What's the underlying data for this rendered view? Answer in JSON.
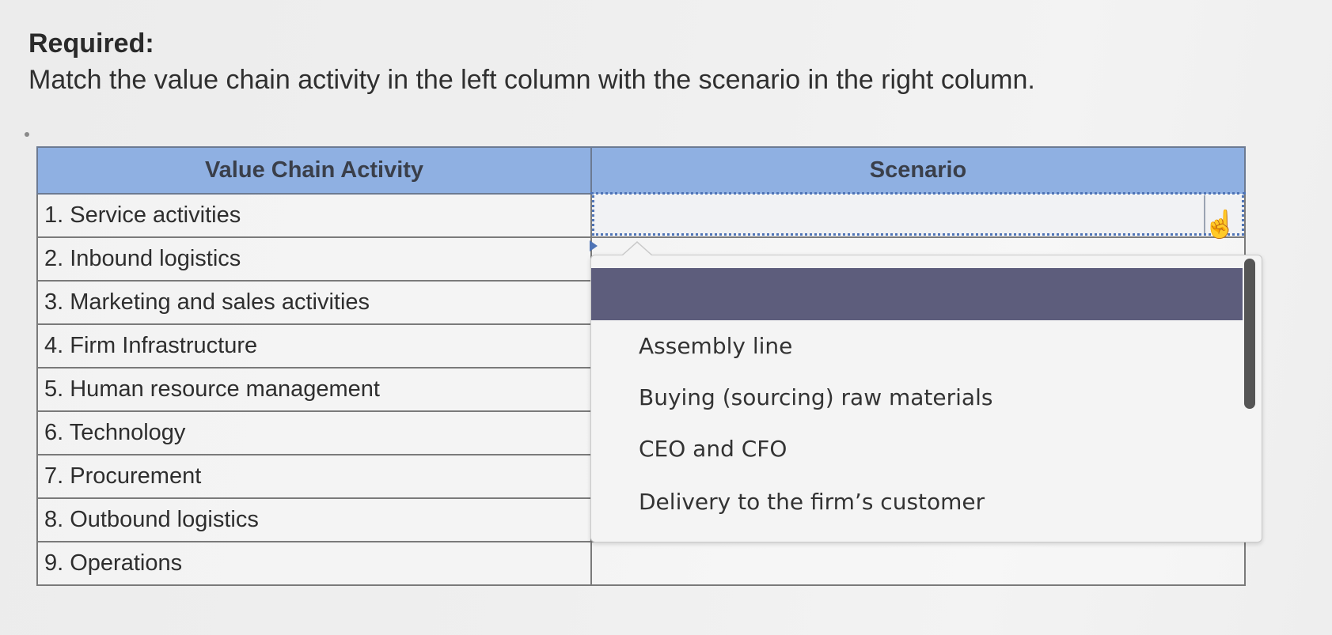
{
  "header": {
    "required_label": "Required:",
    "instruction": "Match the value chain activity in the left column with the scenario in the right column."
  },
  "table": {
    "columns": [
      "Value Chain Activity",
      "Scenario"
    ],
    "rows": [
      "1. Service activities",
      "2. Inbound logistics",
      "3. Marketing and sales activities",
      "4. Firm Infrastructure",
      "5. Human resource management",
      "6. Technology",
      "7. Procurement",
      "8. Outbound logistics",
      "9. Operations"
    ]
  },
  "dropdown": {
    "selected_value": "",
    "options": [
      "",
      "Assembly line",
      "Buying (sourcing) raw materials",
      "CEO and CFO",
      "Delivery to the firm’s customer"
    ],
    "highlight_color": "#5d5d7c",
    "open": true
  },
  "colors": {
    "header_bg": "#8fb0e2",
    "focus_border": "#4f74b6"
  },
  "icons": {
    "cursor": "hand-pointer-icon",
    "select_arrow": "chevron-down-icon"
  }
}
